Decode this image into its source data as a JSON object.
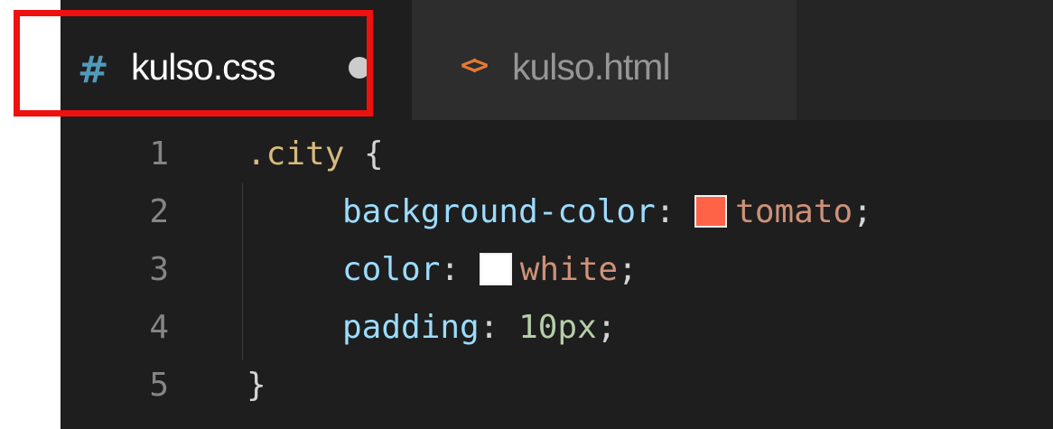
{
  "tabs": {
    "active": {
      "icon": "css-hash-icon",
      "icon_text": "#",
      "label": "kulso.css",
      "modified": true
    },
    "inactive": {
      "icon": "html-code-icon",
      "icon_text": "<>",
      "label": "kulso.html"
    }
  },
  "editor": {
    "lines": [
      {
        "number": "1",
        "tokens": [
          {
            "text": ".city",
            "kind": "selector"
          },
          {
            "text": " {",
            "kind": "brace"
          }
        ]
      },
      {
        "number": "2",
        "tokens": [
          {
            "text": "background-color",
            "kind": "property"
          },
          {
            "text": ": ",
            "kind": "punctuation"
          },
          {
            "text": "tomato",
            "kind": "value",
            "swatch_color": "#ff6347"
          },
          {
            "text": ";",
            "kind": "punctuation"
          }
        ]
      },
      {
        "number": "3",
        "tokens": [
          {
            "text": "color",
            "kind": "property"
          },
          {
            "text": ": ",
            "kind": "punctuation"
          },
          {
            "text": "white",
            "kind": "value",
            "swatch_color": "#ffffff"
          },
          {
            "text": ";",
            "kind": "punctuation"
          }
        ]
      },
      {
        "number": "4",
        "tokens": [
          {
            "text": "padding",
            "kind": "property"
          },
          {
            "text": ": ",
            "kind": "punctuation"
          },
          {
            "text": "10px",
            "kind": "number"
          },
          {
            "text": ";",
            "kind": "punctuation"
          }
        ]
      },
      {
        "number": "5",
        "tokens": [
          {
            "text": "}",
            "kind": "brace"
          }
        ]
      }
    ]
  },
  "colors": {
    "editor_background": "#1e1e1e",
    "tab_bar_background": "#252526",
    "active_tab_background": "#1e1e1e",
    "inactive_tab_background": "#2d2d2d",
    "highlight_outline": "#ef1010",
    "selector": "#d7ba7d",
    "property": "#9cdcfe",
    "value": "#ce9178",
    "number": "#b5cea8",
    "line_number": "#858585"
  }
}
